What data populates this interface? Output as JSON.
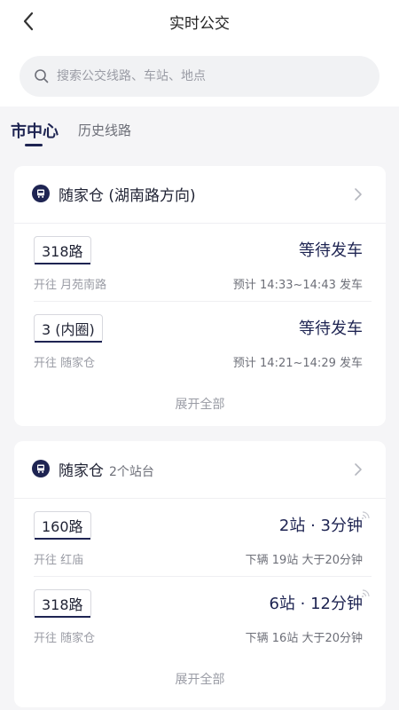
{
  "header": {
    "title": "实时公交",
    "search_placeholder": "搜索公交线路、车站、地点"
  },
  "tabs": [
    {
      "label": "市中心",
      "active": true
    },
    {
      "label": "历史线路",
      "active": false
    }
  ],
  "cards": [
    {
      "stop_name": "随家仓 (湖南路方向)",
      "stop_sub": "",
      "routes": [
        {
          "route": "318路",
          "dest": "开往 月苑南路",
          "status": "等待发车",
          "eta": "预计 14:33~14:43 发车"
        },
        {
          "route": "3 (内圈)",
          "dest": "开往 随家仓",
          "status": "等待发车",
          "eta": "预计 14:21~14:29 发车"
        }
      ],
      "expand_label": "展开全部"
    },
    {
      "stop_name": "随家仓",
      "stop_sub": "2个站台",
      "routes": [
        {
          "route": "160路",
          "dest": "开往 红庙",
          "status": "2站 · 3分钟",
          "eta": "下辆 19站 大于20分钟"
        },
        {
          "route": "318路",
          "dest": "开往 随家仓",
          "status": "6站 · 12分钟",
          "eta": "下辆 16站 大于20分钟"
        }
      ],
      "expand_label": "展开全部"
    }
  ],
  "colors": {
    "accent": "#1e2452",
    "muted": "#9a9ca5",
    "background": "#f5f5f7"
  }
}
